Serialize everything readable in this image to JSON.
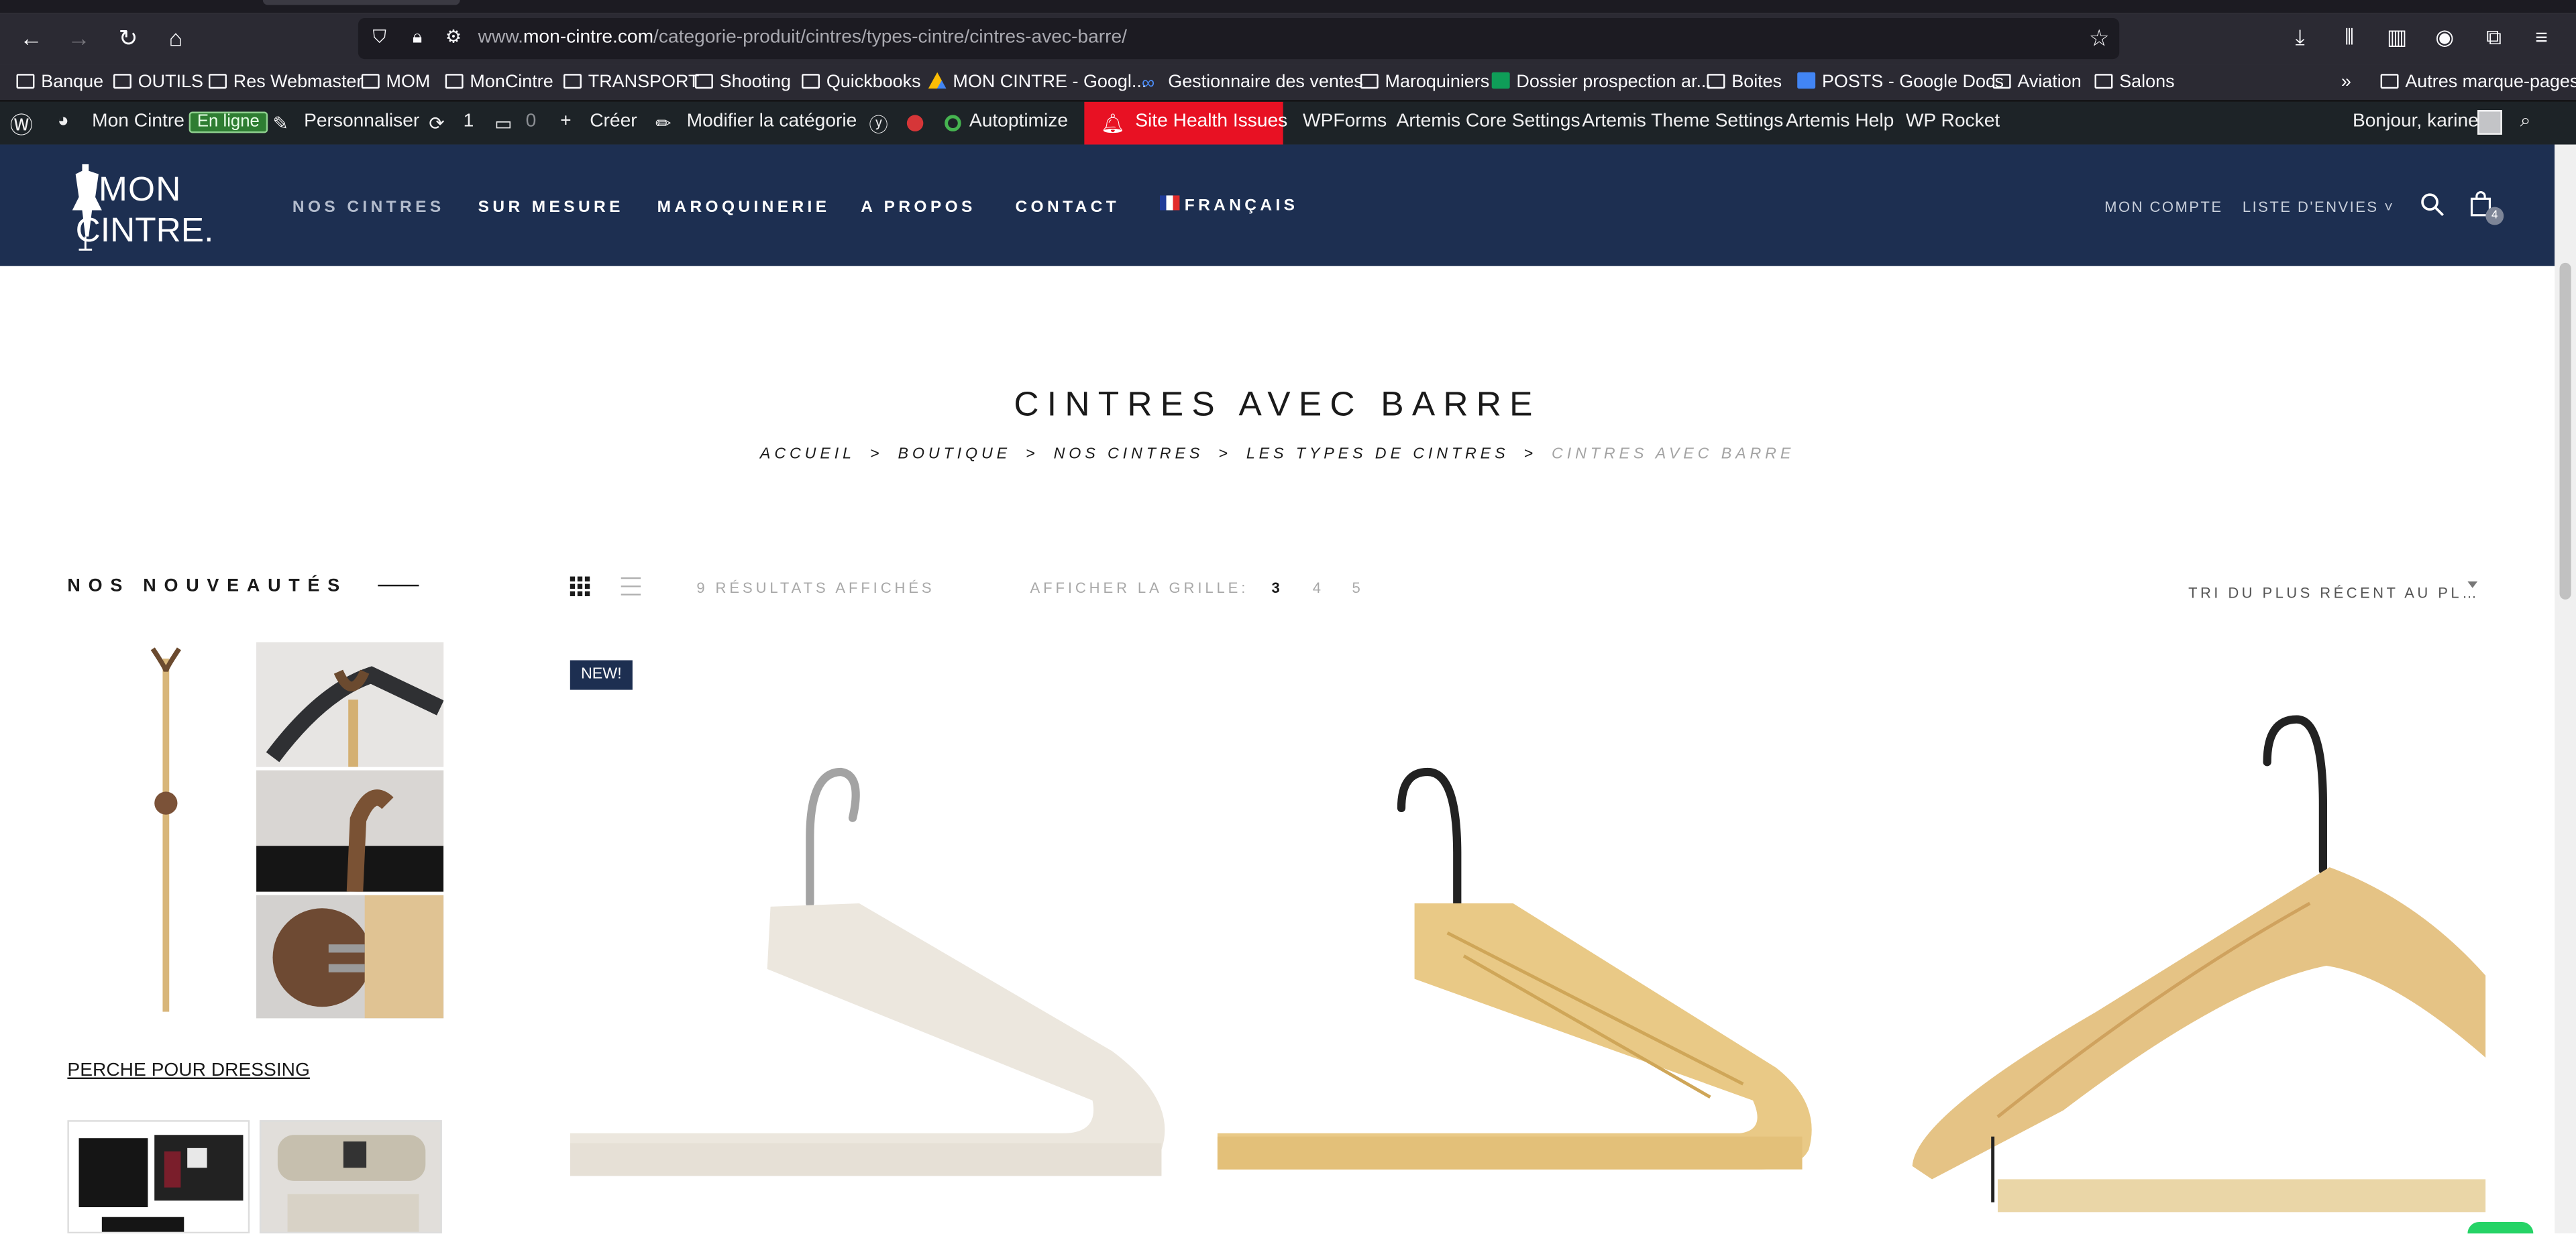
{
  "browser": {
    "url_prefix": "www.",
    "url_domain": "mon-cintre.com",
    "url_path": "/categorie-produit/cintres/types-cintre/cintres-avec-barre/",
    "bookmarks": [
      {
        "label": "Banque",
        "icon": "folder-icon"
      },
      {
        "label": "OUTILS",
        "icon": "folder-icon"
      },
      {
        "label": "Res Webmaster",
        "icon": "folder-icon"
      },
      {
        "label": "MOM",
        "icon": "folder-icon"
      },
      {
        "label": "MonCintre",
        "icon": "folder-icon"
      },
      {
        "label": "TRANSPORT",
        "icon": "folder-icon"
      },
      {
        "label": "Shooting",
        "icon": "folder-icon"
      },
      {
        "label": "Quickbooks",
        "icon": "folder-icon"
      },
      {
        "label": "MON CINTRE - Googl...",
        "icon": "google-drive-icon"
      },
      {
        "label": "Gestionnaire des ventes",
        "icon": "meta-icon"
      },
      {
        "label": "Maroquiniers",
        "icon": "folder-icon"
      },
      {
        "label": "Dossier prospection ar...",
        "icon": "google-sheets-icon"
      },
      {
        "label": "Boites",
        "icon": "folder-icon"
      },
      {
        "label": "POSTS - Google Docs",
        "icon": "google-docs-icon"
      },
      {
        "label": "Aviation",
        "icon": "folder-icon"
      },
      {
        "label": "Salons",
        "icon": "folder-icon"
      }
    ],
    "other_bookmarks": "Autres marque-pages"
  },
  "adminbar": {
    "site_name": "Mon Cintre",
    "online_badge": "En ligne",
    "customize": "Personnaliser",
    "updates_count": "1",
    "comments_count": "0",
    "create": "Créer",
    "edit_category": "Modifier la catégorie",
    "autoptimize": "Autoptimize",
    "site_health": "Site Health Issues",
    "wpforms": "WPForms",
    "artemis_core": "Artemis Core Settings",
    "artemis_theme": "Artemis Theme Settings",
    "artemis_help": "Artemis Help",
    "wp_rocket": "WP Rocket",
    "greeting": "Bonjour, karine"
  },
  "header": {
    "logo_line1": "MON",
    "logo_line2": "CINTRE.",
    "menu": [
      "NOS CINTRES",
      "SUR MESURE",
      "MAROQUINERIE",
      "A PROPOS",
      "CONTACT"
    ],
    "language": "FRANÇAIS",
    "account": "MON COMPTE",
    "wishlist": "LISTE D'ENVIES",
    "cart_count": "4"
  },
  "page": {
    "title": "CINTRES AVEC BARRE",
    "breadcrumb": [
      "ACCUEIL",
      "BOUTIQUE",
      "NOS CINTRES",
      "LES TYPES DE CINTRES",
      "CINTRES AVEC BARRE"
    ],
    "breadcrumb_sep": ">"
  },
  "sidebar": {
    "title": "NOS NOUVEAUTÉS",
    "product_name": "PERCHE POUR DRESSING"
  },
  "shop": {
    "results": "9 RÉSULTATS AFFICHÉS",
    "grid_label": "AFFICHER LA GRILLE:",
    "grid_options": [
      "3",
      "4",
      "5"
    ],
    "grid_selected": "3",
    "sort": "TRI DU PLUS RÉCENT AU PL…",
    "new_badge": "NEW!"
  },
  "colors": {
    "header_bg": "#1d2f51",
    "adminbar_bg": "#1d2327",
    "health_red": "#e81123",
    "browser_chrome": "#2b2a33"
  }
}
